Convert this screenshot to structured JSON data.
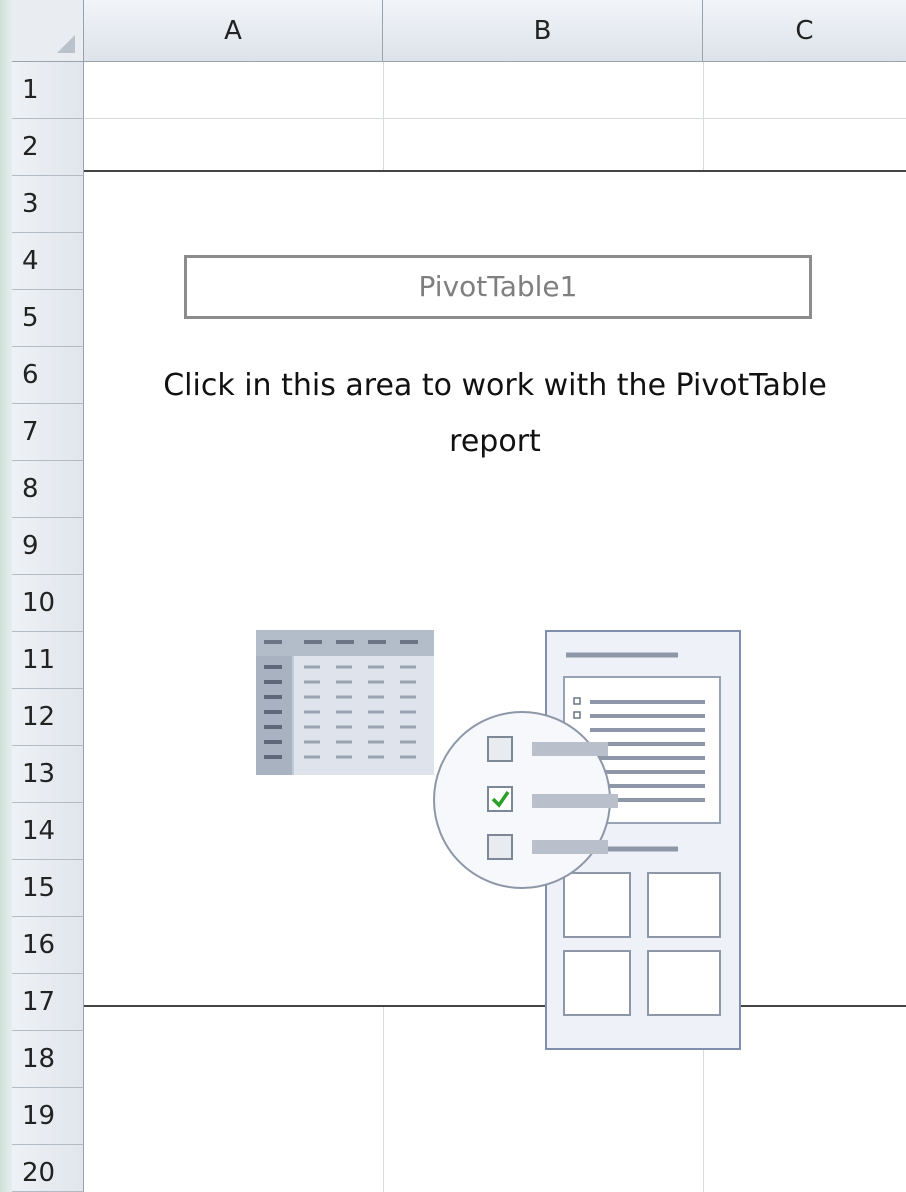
{
  "columns": [
    "A",
    "B",
    "C"
  ],
  "rows": [
    "1",
    "2",
    "3",
    "4",
    "5",
    "6",
    "7",
    "8",
    "9",
    "10",
    "11",
    "12",
    "13",
    "14",
    "15",
    "16",
    "17",
    "18",
    "19",
    "20"
  ],
  "pivot": {
    "name": "PivotTable1",
    "instruction_line1": "Click in this area to work with the PivotTable",
    "instruction_line2": "report"
  },
  "colors": {
    "header_bg": "#e1e6ec",
    "pivot_border": "#444444",
    "name_text": "#7f7f7f",
    "illustration_blue": "#b6bfcf",
    "check_green": "#2aa02a"
  }
}
